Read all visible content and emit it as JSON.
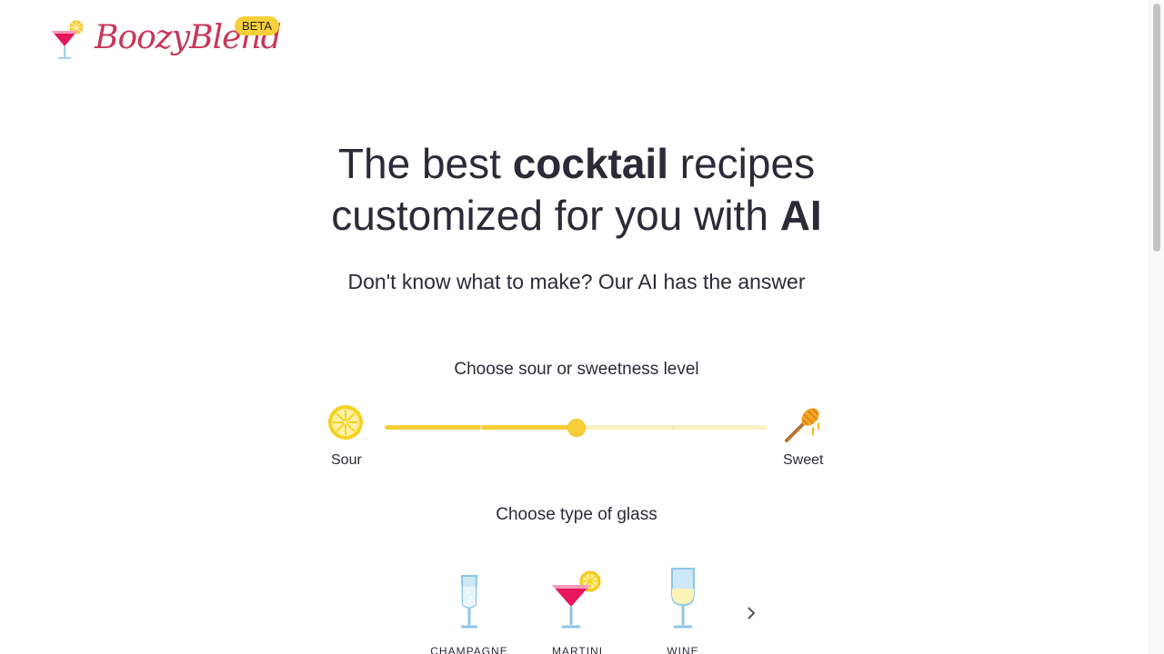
{
  "brand": {
    "name": "BoozyBlend",
    "badge": "BETA"
  },
  "hero": {
    "title_part1": "The best ",
    "title_bold1": "cocktail",
    "title_part2": " recipes",
    "title_part3": "customized for you with ",
    "title_bold2": "AI",
    "subtitle": "Don't know what to make? Our AI has the answer"
  },
  "sweetness": {
    "label": "Choose sour or sweetness level",
    "left_label": "Sour",
    "right_label": "Sweet",
    "left_icon": "lemon-icon",
    "right_icon": "honey-dipper-icon",
    "value": 0.5,
    "steps": 5
  },
  "glass": {
    "label": "Choose type of glass",
    "options": [
      {
        "name": "CHAMPAGNE",
        "icon": "champagne-glass-icon"
      },
      {
        "name": "MARTINI",
        "icon": "martini-glass-icon"
      },
      {
        "name": "WINE",
        "icon": "wine-glass-icon"
      }
    ],
    "next_icon": "chevron-right-icon"
  },
  "colors": {
    "accent_yellow": "#f7cf3a",
    "brand_red": "#c8365a",
    "text": "#2b2b38"
  }
}
